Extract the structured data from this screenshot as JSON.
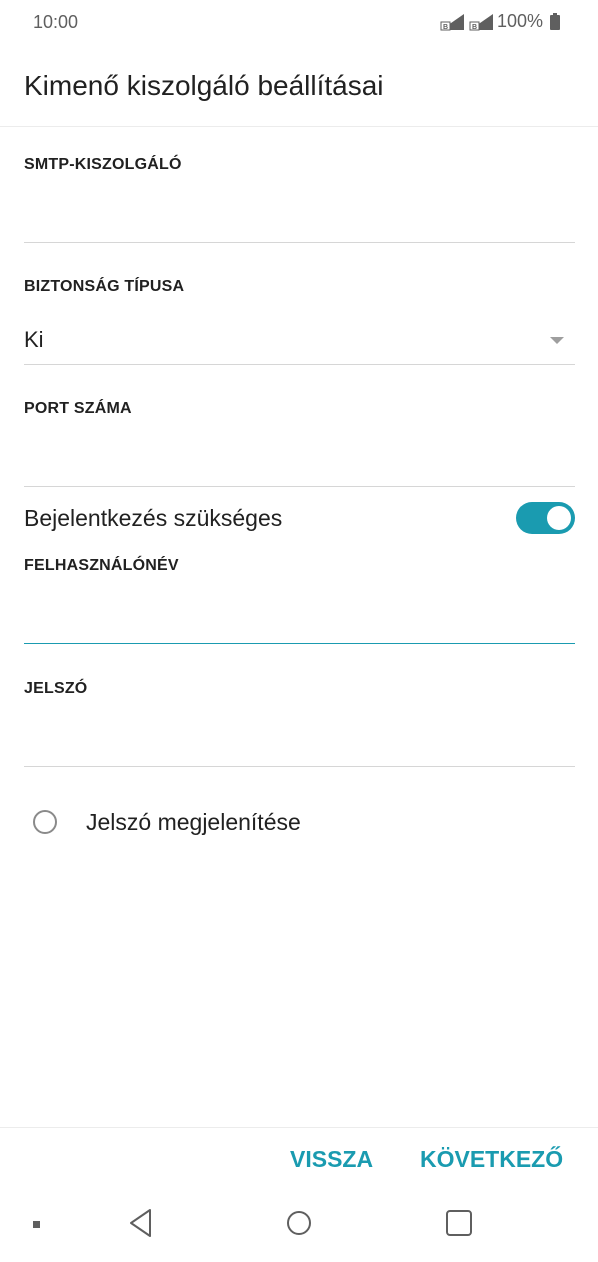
{
  "status_bar": {
    "time": "10:00",
    "battery": "100%",
    "sim1_label": "B",
    "sim2_label": "B"
  },
  "header": {
    "title": "Kimenő kiszolgáló beállításai"
  },
  "form": {
    "smtp_server": {
      "label": "SMTP-KISZOLGÁLÓ",
      "value": ""
    },
    "security_type": {
      "label": "BIZTONSÁG TÍPUSA",
      "value": "Ki"
    },
    "port": {
      "label": "PORT SZÁMA",
      "value": ""
    },
    "login_required": {
      "label": "Bejelentkezés szükséges",
      "enabled": true
    },
    "username": {
      "label": "FELHASZNÁLÓNÉV",
      "value": ""
    },
    "password": {
      "label": "JELSZÓ",
      "value": ""
    },
    "show_password": {
      "label": "Jelszó megjelenítése",
      "checked": false
    }
  },
  "actions": {
    "back_label": "VISSZA",
    "next_label": "KÖVETKEZŐ"
  },
  "colors": {
    "accent": "#1a9bb0",
    "text": "#212121",
    "divider": "#d6d6d6"
  },
  "icons": {
    "signal": "signal-icon",
    "battery": "battery-icon",
    "dropdown": "chevron-down-icon",
    "nav_back": "nav-back-icon",
    "nav_home": "nav-home-icon",
    "nav_recent": "nav-recent-icon"
  }
}
